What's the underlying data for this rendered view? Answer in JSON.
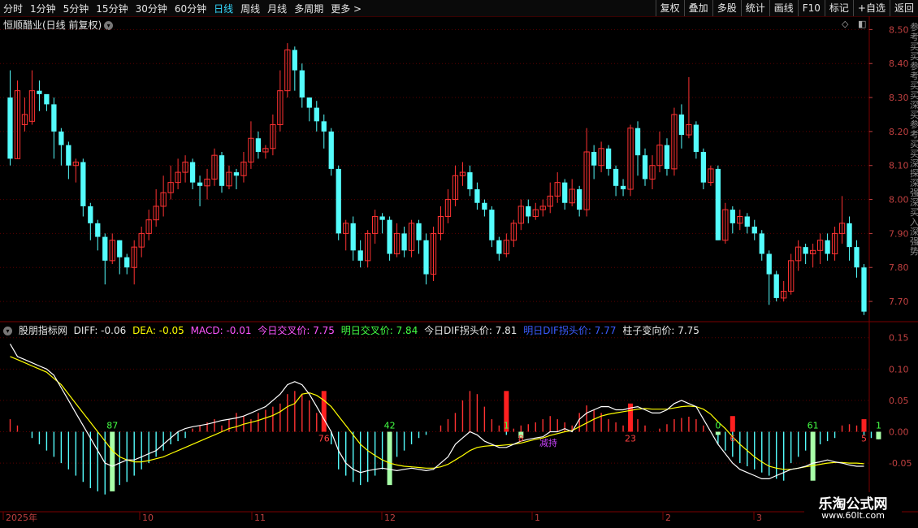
{
  "toolbar": {
    "periods": [
      "分时",
      "1分钟",
      "5分钟",
      "15分钟",
      "30分钟",
      "60分钟",
      "日线",
      "周线",
      "月线",
      "多周期",
      "更多 >"
    ],
    "active_period": "日线",
    "actions": [
      "复权",
      "叠加",
      "多股",
      "统计",
      "画线",
      "F10",
      "标记",
      "+自选",
      "返回"
    ]
  },
  "main": {
    "title": "恒顺醋业(日线 前复权)",
    "y_ticks": [
      "8.50",
      "8.40",
      "8.30",
      "8.20",
      "8.10",
      "8.00",
      "7.90",
      "7.80",
      "7.70"
    ]
  },
  "indicator": {
    "name": "股朋指标网",
    "diff": "DIFF: -0.06",
    "dea": "DEA: -0.05",
    "macd": "MACD: -0.01",
    "today_cross": "今日交叉价: 7.75",
    "tomorrow_cross": "明日交叉价: 7.84",
    "today_dif_turn": "今日DIF拐头价: 7.81",
    "tomorrow_dif_turn": "明日DIF拐头价: 7.77",
    "bar_change": "柱子变向价: 7.75",
    "y_ticks": [
      "0.15",
      "0.10",
      "0.05",
      "0.00",
      "-0.05"
    ],
    "bar_labels": [
      "87",
      "76",
      "42",
      "1",
      "8",
      "23",
      "0",
      "6",
      "61",
      "5",
      "1"
    ],
    "pink_label": "减持"
  },
  "x_axis": {
    "labels": [
      "2025年",
      "10",
      "11",
      "12",
      "1",
      "2",
      "3"
    ]
  },
  "side_text": "参考买买参考买买深买参考买买深探深强深买入深强势",
  "watermark": {
    "line1": "乐淘公式网",
    "line2": "www.60lt.com"
  },
  "colors": {
    "up": "#ff3232",
    "down": "#54fcfc",
    "diff": "#ffffff",
    "dea": "#ffff00",
    "macd_up": "#ff3232",
    "macd_down": "#54fcfc"
  },
  "chart_data": {
    "type": "candlestick",
    "ylim": [
      7.65,
      8.52
    ],
    "candles": [
      [
        8.3,
        8.12,
        8.38,
        8.1
      ],
      [
        8.12,
        8.32,
        8.35,
        8.12
      ],
      [
        8.22,
        8.25,
        8.3,
        8.2
      ],
      [
        8.23,
        8.32,
        8.38,
        8.22
      ],
      [
        8.32,
        8.31,
        8.35,
        8.26
      ],
      [
        8.31,
        8.28,
        8.3,
        8.26
      ],
      [
        8.28,
        8.2,
        8.3,
        8.12
      ],
      [
        8.2,
        8.16,
        8.21,
        8.1
      ],
      [
        8.16,
        8.1,
        8.17,
        8.06
      ],
      [
        8.1,
        8.11,
        8.12,
        8.05
      ],
      [
        8.11,
        7.98,
        8.12,
        7.95
      ],
      [
        7.98,
        7.93,
        7.99,
        7.88
      ],
      [
        7.93,
        7.89,
        7.94,
        7.85
      ],
      [
        7.89,
        7.82,
        7.9,
        7.75
      ],
      [
        7.82,
        7.88,
        7.9,
        7.81
      ],
      [
        7.88,
        7.83,
        7.88,
        7.78
      ],
      [
        7.83,
        7.8,
        7.84,
        7.78
      ],
      [
        7.8,
        7.86,
        7.88,
        7.75
      ],
      [
        7.86,
        7.9,
        7.92,
        7.83
      ],
      [
        7.9,
        7.94,
        7.97,
        7.88
      ],
      [
        7.94,
        7.98,
        8.03,
        7.92
      ],
      [
        7.98,
        8.02,
        8.07,
        7.95
      ],
      [
        8.02,
        8.05,
        8.1,
        8.0
      ],
      [
        8.05,
        8.08,
        8.12,
        8.03
      ],
      [
        8.08,
        8.11,
        8.13,
        8.05
      ],
      [
        8.11,
        8.05,
        8.12,
        8.03
      ],
      [
        8.05,
        8.04,
        8.07,
        7.98
      ],
      [
        8.04,
        8.06,
        8.09,
        8.0
      ],
      [
        8.06,
        8.13,
        8.15,
        8.04
      ],
      [
        8.13,
        8.04,
        8.14,
        8.02
      ],
      [
        8.04,
        8.08,
        8.1,
        8.03
      ],
      [
        8.08,
        8.07,
        8.09,
        8.03
      ],
      [
        8.07,
        8.11,
        8.14,
        8.05
      ],
      [
        8.11,
        8.18,
        8.23,
        8.09
      ],
      [
        8.18,
        8.14,
        8.2,
        8.12
      ],
      [
        8.14,
        8.15,
        8.16,
        8.12
      ],
      [
        8.15,
        8.22,
        8.25,
        8.13
      ],
      [
        8.22,
        8.32,
        8.38,
        8.2
      ],
      [
        8.32,
        8.44,
        8.46,
        8.3
      ],
      [
        8.44,
        8.38,
        8.45,
        8.32
      ],
      [
        8.38,
        8.3,
        8.4,
        8.27
      ],
      [
        8.3,
        8.27,
        8.3,
        8.23
      ],
      [
        8.27,
        8.23,
        8.29,
        8.2
      ],
      [
        8.23,
        8.2,
        8.25,
        8.15
      ],
      [
        8.2,
        8.09,
        8.21,
        8.07
      ],
      [
        8.09,
        7.9,
        8.1,
        7.88
      ],
      [
        7.9,
        7.93,
        7.94,
        7.85
      ],
      [
        7.93,
        7.85,
        7.95,
        7.82
      ],
      [
        7.85,
        7.82,
        7.88,
        7.8
      ],
      [
        7.82,
        7.9,
        7.91,
        7.8
      ],
      [
        7.9,
        7.95,
        7.97,
        7.87
      ],
      [
        7.95,
        7.94,
        7.96,
        7.9
      ],
      [
        7.94,
        7.84,
        7.95,
        7.82
      ],
      [
        7.84,
        7.9,
        7.93,
        7.83
      ],
      [
        7.9,
        7.85,
        7.92,
        7.83
      ],
      [
        7.85,
        7.93,
        7.94,
        7.83
      ],
      [
        7.93,
        7.88,
        7.94,
        7.84
      ],
      [
        7.88,
        7.78,
        7.9,
        7.75
      ],
      [
        7.78,
        7.9,
        7.92,
        7.76
      ],
      [
        7.9,
        7.95,
        7.98,
        7.88
      ],
      [
        7.95,
        8.0,
        8.03,
        7.93
      ],
      [
        8.0,
        8.07,
        8.1,
        7.98
      ],
      [
        8.07,
        8.08,
        8.11,
        8.04
      ],
      [
        8.08,
        8.03,
        8.1,
        8.01
      ],
      [
        8.03,
        7.99,
        8.05,
        7.97
      ],
      [
        7.99,
        7.97,
        8.0,
        7.95
      ],
      [
        7.97,
        7.88,
        7.98,
        7.86
      ],
      [
        7.88,
        7.84,
        7.89,
        7.82
      ],
      [
        7.84,
        7.88,
        7.9,
        7.83
      ],
      [
        7.88,
        7.93,
        7.94,
        7.86
      ],
      [
        7.93,
        7.98,
        8.0,
        7.91
      ],
      [
        7.98,
        7.95,
        8.0,
        7.93
      ],
      [
        7.95,
        7.97,
        7.99,
        7.94
      ],
      [
        7.97,
        7.98,
        8.0,
        7.95
      ],
      [
        7.98,
        8.01,
        8.05,
        7.96
      ],
      [
        8.01,
        8.05,
        8.08,
        7.99
      ],
      [
        8.05,
        7.99,
        8.06,
        7.97
      ],
      [
        7.99,
        8.03,
        8.06,
        7.98
      ],
      [
        8.03,
        7.97,
        8.04,
        7.95
      ],
      [
        7.97,
        8.14,
        8.21,
        7.95
      ],
      [
        8.14,
        8.1,
        8.16,
        8.06
      ],
      [
        8.1,
        8.15,
        8.17,
        8.08
      ],
      [
        8.15,
        8.09,
        8.16,
        8.07
      ],
      [
        8.09,
        8.04,
        8.1,
        8.01
      ],
      [
        8.04,
        8.03,
        8.06,
        8.01
      ],
      [
        8.03,
        8.21,
        8.22,
        8.01
      ],
      [
        8.21,
        8.13,
        8.23,
        8.07
      ],
      [
        8.13,
        8.06,
        8.15,
        8.04
      ],
      [
        8.06,
        8.1,
        8.13,
        8.03
      ],
      [
        8.1,
        8.16,
        8.2,
        8.08
      ],
      [
        8.16,
        8.09,
        8.18,
        8.07
      ],
      [
        8.09,
        8.25,
        8.27,
        8.07
      ],
      [
        8.25,
        8.19,
        8.28,
        8.15
      ],
      [
        8.19,
        8.22,
        8.36,
        8.18
      ],
      [
        8.22,
        8.14,
        8.23,
        8.12
      ],
      [
        8.14,
        8.05,
        8.15,
        8.03
      ],
      [
        8.05,
        8.09,
        8.1,
        8.04
      ],
      [
        8.09,
        7.88,
        8.1,
        7.88
      ],
      [
        7.88,
        7.97,
        7.99,
        7.87
      ],
      [
        7.97,
        7.93,
        7.98,
        7.9
      ],
      [
        7.93,
        7.95,
        7.97,
        7.91
      ],
      [
        7.95,
        7.92,
        7.96,
        7.9
      ],
      [
        7.92,
        7.9,
        7.94,
        7.88
      ],
      [
        7.9,
        7.84,
        7.91,
        7.82
      ],
      [
        7.84,
        7.78,
        7.85,
        7.69
      ],
      [
        7.78,
        7.71,
        7.79,
        7.7
      ],
      [
        7.71,
        7.73,
        7.76,
        7.7
      ],
      [
        7.73,
        7.82,
        7.84,
        7.72
      ],
      [
        7.82,
        7.86,
        7.88,
        7.79
      ],
      [
        7.86,
        7.84,
        7.87,
        7.81
      ],
      [
        7.84,
        7.85,
        7.87,
        7.8
      ],
      [
        7.85,
        7.88,
        7.9,
        7.81
      ],
      [
        7.88,
        7.84,
        7.9,
        7.82
      ],
      [
        7.84,
        7.9,
        7.92,
        7.82
      ],
      [
        7.9,
        7.93,
        8.01,
        7.87
      ],
      [
        7.93,
        7.86,
        7.95,
        7.82
      ],
      [
        7.86,
        7.8,
        7.88,
        7.77
      ],
      [
        7.8,
        7.67,
        7.81,
        7.66
      ]
    ],
    "macd": [
      0.02,
      0.01,
      0.0,
      -0.01,
      -0.02,
      -0.03,
      -0.04,
      -0.05,
      -0.06,
      -0.07,
      -0.08,
      -0.09,
      -0.095,
      -0.1,
      -0.09,
      -0.085,
      -0.08,
      -0.07,
      -0.06,
      -0.05,
      -0.04,
      -0.03,
      -0.02,
      -0.015,
      -0.01,
      0.005,
      0.01,
      0.015,
      0.02,
      0.01,
      0.02,
      0.03,
      0.025,
      0.02,
      0.03,
      0.035,
      0.04,
      0.045,
      0.06,
      0.065,
      0.06,
      0.05,
      0.03,
      0.01,
      -0.02,
      -0.06,
      -0.07,
      -0.08,
      -0.085,
      -0.08,
      -0.07,
      -0.06,
      -0.05,
      -0.04,
      -0.03,
      -0.02,
      -0.01,
      -0.005,
      0.0,
      0.01,
      0.02,
      0.03,
      0.05,
      0.065,
      0.06,
      0.04,
      0.02,
      0.01,
      -0.005,
      0.005,
      0.01,
      0.012,
      0.015,
      0.02,
      0.025,
      0.02,
      0.015,
      0.01,
      0.03,
      0.042,
      0.035,
      0.03,
      0.02,
      0.015,
      0.01,
      0.015,
      0.02,
      0.01,
      0.0,
      0.005,
      0.012,
      0.02,
      0.022,
      0.024,
      0.02,
      0.01,
      0.0,
      -0.02,
      -0.03,
      -0.04,
      -0.05,
      -0.055,
      -0.06,
      -0.065,
      -0.07,
      -0.075,
      -0.078,
      -0.05,
      -0.04,
      -0.03,
      -0.025,
      -0.02,
      -0.015,
      -0.01,
      0.01,
      0.012,
      0.01,
      -0.005,
      -0.01,
      -0.012
    ],
    "diff": [
      0.14,
      0.12,
      0.115,
      0.11,
      0.105,
      0.1,
      0.09,
      0.07,
      0.05,
      0.03,
      0.01,
      -0.01,
      -0.03,
      -0.05,
      -0.055,
      -0.05,
      -0.045,
      -0.045,
      -0.04,
      -0.035,
      -0.03,
      -0.02,
      -0.01,
      0.0,
      0.005,
      0.008,
      0.01,
      0.012,
      0.015,
      0.018,
      0.02,
      0.022,
      0.025,
      0.03,
      0.035,
      0.04,
      0.05,
      0.06,
      0.075,
      0.08,
      0.075,
      0.06,
      0.04,
      0.02,
      0.0,
      -0.03,
      -0.05,
      -0.06,
      -0.065,
      -0.062,
      -0.06,
      -0.058,
      -0.06,
      -0.062,
      -0.06,
      -0.058,
      -0.06,
      -0.062,
      -0.06,
      -0.05,
      -0.04,
      -0.02,
      -0.01,
      0.0,
      -0.005,
      -0.015,
      -0.02,
      -0.025,
      -0.025,
      -0.02,
      -0.015,
      -0.012,
      -0.01,
      -0.008,
      0.0,
      0.0,
      0.005,
      0.0,
      0.02,
      0.03,
      0.035,
      0.04,
      0.04,
      0.035,
      0.035,
      0.038,
      0.04,
      0.035,
      0.03,
      0.03,
      0.035,
      0.045,
      0.05,
      0.045,
      0.04,
      0.02,
      0.0,
      -0.02,
      -0.035,
      -0.05,
      -0.06,
      -0.065,
      -0.07,
      -0.075,
      -0.075,
      -0.07,
      -0.065,
      -0.06,
      -0.058,
      -0.055,
      -0.05,
      -0.048,
      -0.045,
      -0.048,
      -0.05,
      -0.053,
      -0.055,
      -0.055
    ],
    "dea": [
      0.12,
      0.115,
      0.11,
      0.105,
      0.1,
      0.095,
      0.085,
      0.075,
      0.06,
      0.045,
      0.03,
      0.015,
      0.0,
      -0.015,
      -0.03,
      -0.04,
      -0.045,
      -0.048,
      -0.048,
      -0.046,
      -0.043,
      -0.04,
      -0.035,
      -0.03,
      -0.025,
      -0.02,
      -0.015,
      -0.01,
      -0.005,
      0.0,
      0.005,
      0.008,
      0.012,
      0.015,
      0.018,
      0.022,
      0.026,
      0.032,
      0.04,
      0.045,
      0.06,
      0.062,
      0.058,
      0.05,
      0.04,
      0.025,
      0.01,
      -0.005,
      -0.02,
      -0.03,
      -0.038,
      -0.045,
      -0.05,
      -0.053,
      -0.055,
      -0.056,
      -0.057,
      -0.058,
      -0.058,
      -0.056,
      -0.052,
      -0.045,
      -0.038,
      -0.03,
      -0.025,
      -0.023,
      -0.022,
      -0.022,
      -0.021,
      -0.02,
      -0.018,
      -0.015,
      -0.012,
      -0.01,
      -0.006,
      -0.003,
      0.0,
      0.002,
      0.008,
      0.014,
      0.02,
      0.025,
      0.028,
      0.03,
      0.032,
      0.034,
      0.036,
      0.037,
      0.036,
      0.036,
      0.036,
      0.038,
      0.04,
      0.041,
      0.04,
      0.036,
      0.028,
      0.016,
      0.005,
      -0.008,
      -0.02,
      -0.03,
      -0.04,
      -0.048,
      -0.055,
      -0.058,
      -0.06,
      -0.06,
      -0.058,
      -0.056,
      -0.054,
      -0.052,
      -0.05,
      -0.049,
      -0.049,
      -0.05,
      -0.05,
      -0.051
    ]
  }
}
